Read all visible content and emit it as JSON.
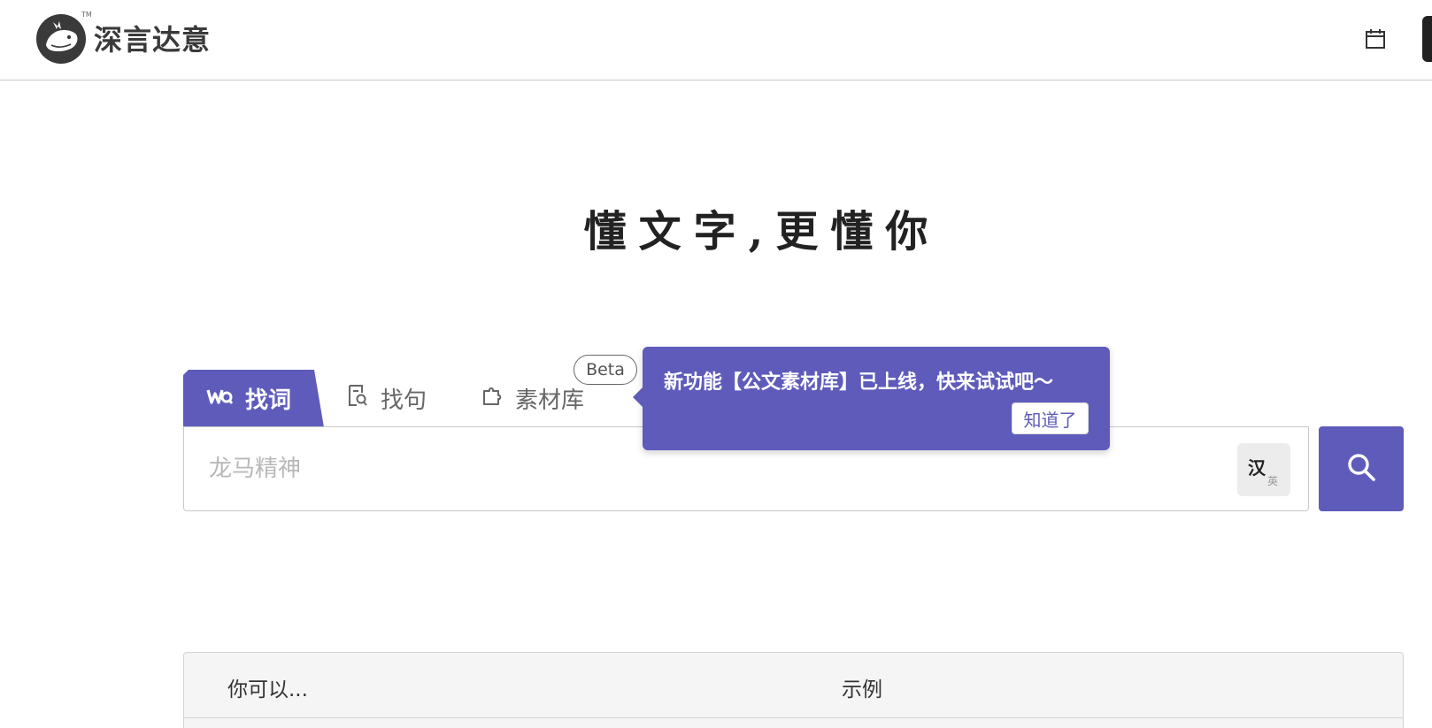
{
  "header": {
    "brand": "深言达意",
    "tm": "TM",
    "icons": {
      "logo": "whale-logo-icon",
      "calendar": "calendar-icon"
    }
  },
  "slogan": "懂文字,更懂你",
  "tabs": [
    {
      "label": "找词",
      "icon": "wq-icon",
      "active": true
    },
    {
      "label": "找句",
      "icon": "document-search-icon",
      "active": false
    },
    {
      "label": "素材库",
      "icon": "puzzle-icon",
      "active": false
    }
  ],
  "beta_badge": "Beta",
  "search": {
    "placeholder": "龙马精神",
    "lang_toggle": {
      "primary": "汉",
      "secondary": "英"
    }
  },
  "tooltip": {
    "message": "新功能【公文素材库】已上线，快来试试吧～",
    "button": "知道了"
  },
  "table": {
    "headers": [
      "你可以...",
      "示例"
    ]
  },
  "colors": {
    "accent": "#5e5bbb",
    "border": "#c8c8c8",
    "table_bg": "#f5f5f5"
  }
}
